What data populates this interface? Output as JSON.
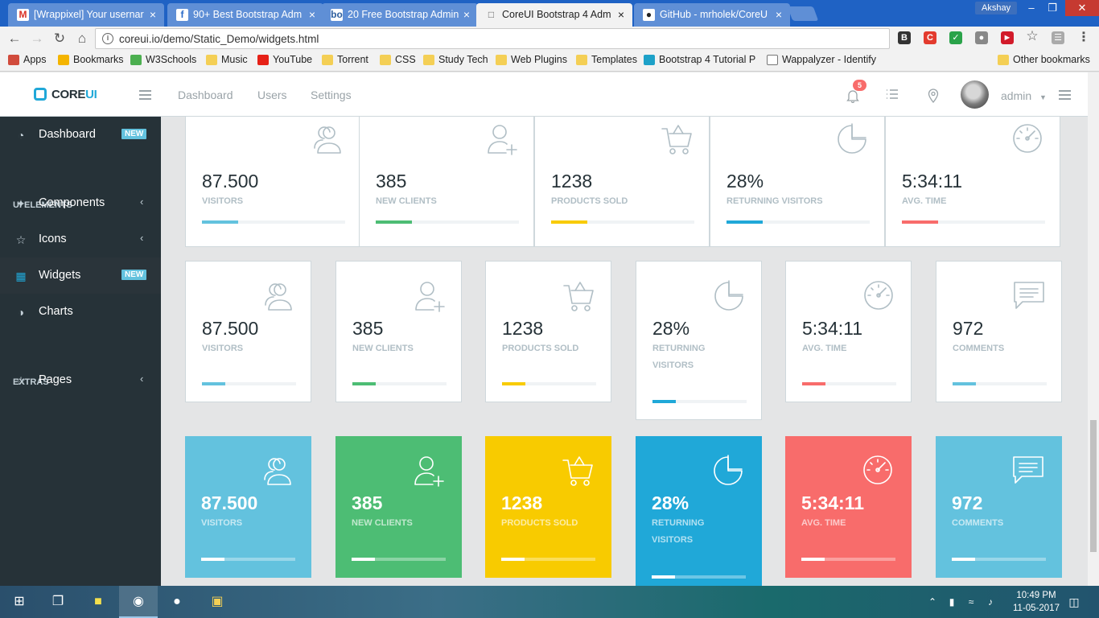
{
  "browser": {
    "tabs": [
      {
        "title": "[Wrappixel] Your usernar",
        "icon": "M",
        "icon_color": "#d93025"
      },
      {
        "title": "90+ Best Bootstrap Adm",
        "icon": "f",
        "icon_color": "#2a6ac8"
      },
      {
        "title": "20 Free Bootstrap Admin",
        "icon": "bo",
        "icon_color": "#2c5e9e"
      },
      {
        "title": "CoreUI Bootstrap 4 Adm",
        "icon": "□",
        "icon_color": "#666666"
      },
      {
        "title": "GitHub - mrholek/CoreU",
        "icon": "●",
        "icon_color": "#222222"
      }
    ],
    "profile_name": "Akshay",
    "url": "coreui.io/demo/Static_Demo/widgets.html",
    "bookmarks": [
      {
        "label": "Apps",
        "icon": "apps-grid-icon"
      },
      {
        "label": "Bookmarks",
        "icon": "star-icon"
      },
      {
        "label": "W3Schools",
        "icon": "w3-icon"
      },
      {
        "label": "Music",
        "icon": "folder-icon"
      },
      {
        "label": "YouTube",
        "icon": "youtube-icon"
      },
      {
        "label": "Torrent",
        "icon": "folder-icon"
      },
      {
        "label": "CSS",
        "icon": "folder-icon"
      },
      {
        "label": "Study Tech",
        "icon": "folder-icon"
      },
      {
        "label": "Web Plugins",
        "icon": "folder-icon"
      },
      {
        "label": "Templates",
        "icon": "folder-icon"
      },
      {
        "label": "Bootstrap 4 Tutorial P",
        "icon": "bootstrap-icon"
      },
      {
        "label": "Wappalyzer - Identify",
        "icon": "page-icon"
      }
    ],
    "other_bookmarks": "Other bookmarks"
  },
  "header": {
    "logo_core": "CORE",
    "logo_ui": "UI",
    "nav": [
      "Dashboard",
      "Users",
      "Settings"
    ],
    "notifications_count": "5",
    "user_name": "admin"
  },
  "sidebar": {
    "items": [
      {
        "label": "Dashboard",
        "icon": "speedometer-icon",
        "badge": "NEW"
      },
      {
        "title": "UI ELEMENTS"
      },
      {
        "label": "Components",
        "icon": "puzzle-icon",
        "arrow": "‹"
      },
      {
        "label": "Icons",
        "icon": "star-icon",
        "arrow": "‹"
      },
      {
        "label": "Widgets",
        "icon": "calculator-icon",
        "badge": "NEW"
      },
      {
        "label": "Charts",
        "icon": "pie-chart-icon"
      },
      {
        "title": "EXTRAS"
      },
      {
        "label": "Pages",
        "icon": "star-icon",
        "arrow": "‹"
      }
    ]
  },
  "widgets": {
    "row1": [
      {
        "value": "87.500",
        "label": "VISITORS",
        "icon": "people-icon",
        "color": "#63c2de",
        "progress": 25
      },
      {
        "value": "385",
        "label": "NEW CLIENTS",
        "icon": "user-follow-icon",
        "color": "#4dbd74",
        "progress": 25
      },
      {
        "value": "1238",
        "label": "PRODUCTS SOLD",
        "icon": "basket-icon",
        "color": "#f8cb00",
        "progress": 25
      },
      {
        "value": "28%",
        "label": "RETURNING VISITORS",
        "icon": "pie-chart-icon",
        "color": "#20a8d8",
        "progress": 25
      },
      {
        "value": "5:34:11",
        "label": "AVG. TIME",
        "icon": "speedometer-icon",
        "color": "#f86c6b",
        "progress": 25
      }
    ],
    "row2": [
      {
        "value": "87.500",
        "label": "VISITORS",
        "icon": "people-icon",
        "color": "#63c2de",
        "progress": 25
      },
      {
        "value": "385",
        "label": "NEW CLIENTS",
        "icon": "user-follow-icon",
        "color": "#4dbd74",
        "progress": 25
      },
      {
        "value": "1238",
        "label": "PRODUCTS SOLD",
        "icon": "basket-icon",
        "color": "#f8cb00",
        "progress": 25
      },
      {
        "value": "28%",
        "label": "RETURNING VISITORS",
        "icon": "pie-chart-icon",
        "color": "#20a8d8",
        "progress": 25
      },
      {
        "value": "5:34:11",
        "label": "AVG. TIME",
        "icon": "speedometer-icon",
        "color": "#f86c6b",
        "progress": 25
      },
      {
        "value": "972",
        "label": "COMMENTS",
        "icon": "speech-icon",
        "color": "#63c2de",
        "progress": 25
      }
    ],
    "row3": [
      {
        "value": "87.500",
        "label": "VISITORS",
        "icon": "people-icon",
        "color": "#63c2de",
        "progress": 25
      },
      {
        "value": "385",
        "label": "NEW CLIENTS",
        "icon": "user-follow-icon",
        "color": "#4dbd74",
        "progress": 25
      },
      {
        "value": "1238",
        "label": "PRODUCTS SOLD",
        "icon": "basket-icon",
        "color": "#f8cb00",
        "progress": 25
      },
      {
        "value": "28%",
        "label": "RETURNING VISITORS",
        "icon": "pie-chart-icon",
        "color": "#20a8d8",
        "progress": 25
      },
      {
        "value": "5:34:11",
        "label": "AVG. TIME",
        "icon": "speedometer-icon",
        "color": "#f86c6b",
        "progress": 25
      },
      {
        "value": "972",
        "label": "COMMENTS",
        "icon": "speech-icon",
        "color": "#63c2de",
        "progress": 25
      }
    ]
  },
  "taskbar": {
    "time": "10:49 PM",
    "date": "11-05-2017"
  }
}
